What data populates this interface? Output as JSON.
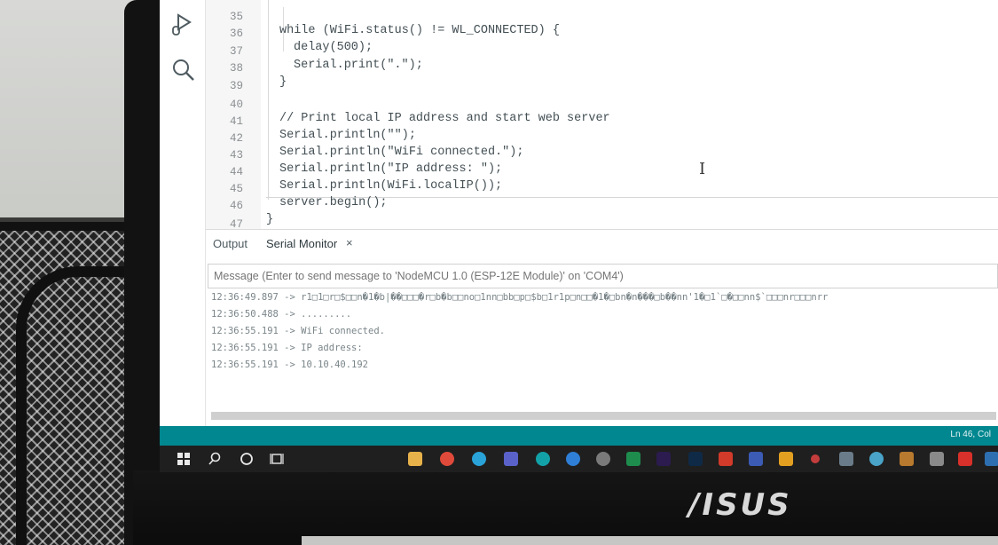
{
  "editor": {
    "lines": [
      {
        "n": "35",
        "code": "while (WiFi.status() != WL_CONNECTED) {",
        "indent": 0
      },
      {
        "n": "36",
        "code": "delay(500);",
        "indent": 1
      },
      {
        "n": "37",
        "code": "Serial.print(\".\");",
        "indent": 1
      },
      {
        "n": "38",
        "code": "}",
        "indent": 0
      },
      {
        "n": "39",
        "code": "",
        "indent": 0
      },
      {
        "n": "40",
        "code": "// Print local IP address and start web server",
        "indent": 0
      },
      {
        "n": "41",
        "code": "Serial.println(\"\");",
        "indent": 0
      },
      {
        "n": "42",
        "code": "Serial.println(\"WiFi connected.\");",
        "indent": 0
      },
      {
        "n": "43",
        "code": "Serial.println(\"IP address: \");",
        "indent": 0
      },
      {
        "n": "44",
        "code": "Serial.println(WiFi.localIP());",
        "indent": 0
      },
      {
        "n": "45",
        "code": "server.begin();",
        "indent": 0
      },
      {
        "n": "46",
        "code": "}",
        "indent": -1
      },
      {
        "n": "47",
        "code": "",
        "indent": 0
      }
    ]
  },
  "panel": {
    "tab_output": "Output",
    "tab_serial": "Serial Monitor",
    "tab_close": "×",
    "message_placeholder": "Message (Enter to send message to 'NodeMCU 1.0 (ESP-12E Module)' on 'COM4')",
    "serial_lines": [
      "12:36:49.897 -> r1□1□r□$□□n�1�b|��□□□�r□b�b□□no□1nn□bb□p□$b□1r1p□n□□�1�□bn�n���□b��nn'1�□1`□�□□nn$`□□□nr□□□nrr",
      "12:36:50.488 -> .........",
      "12:36:55.191 -> WiFi connected.",
      "12:36:55.191 -> IP address:",
      "12:36:55.191 -> 10.10.40.192"
    ]
  },
  "status_bar": {
    "text": "Ln 46, Col"
  },
  "brand": {
    "logo": "/ISUS"
  },
  "colors": {
    "status_bar": "#00878f",
    "taskbar": "#1f1f1f"
  },
  "taskbar_icons": [
    "windows-start-icon",
    "search-icon",
    "cortana-icon",
    "task-view-icon",
    "file-explorer-icon",
    "chrome-icon",
    "telegram-icon",
    "teams-icon",
    "arduino-icon",
    "edge-icon",
    "app-icon",
    "excel-icon",
    "premiere-icon",
    "photoshop-icon",
    "acrobat-icon",
    "visio-icon",
    "app2-icon",
    "app3-icon",
    "app4-icon",
    "app5-icon",
    "app6-icon",
    "app7-icon",
    "pdf-icon",
    "app8-icon"
  ]
}
